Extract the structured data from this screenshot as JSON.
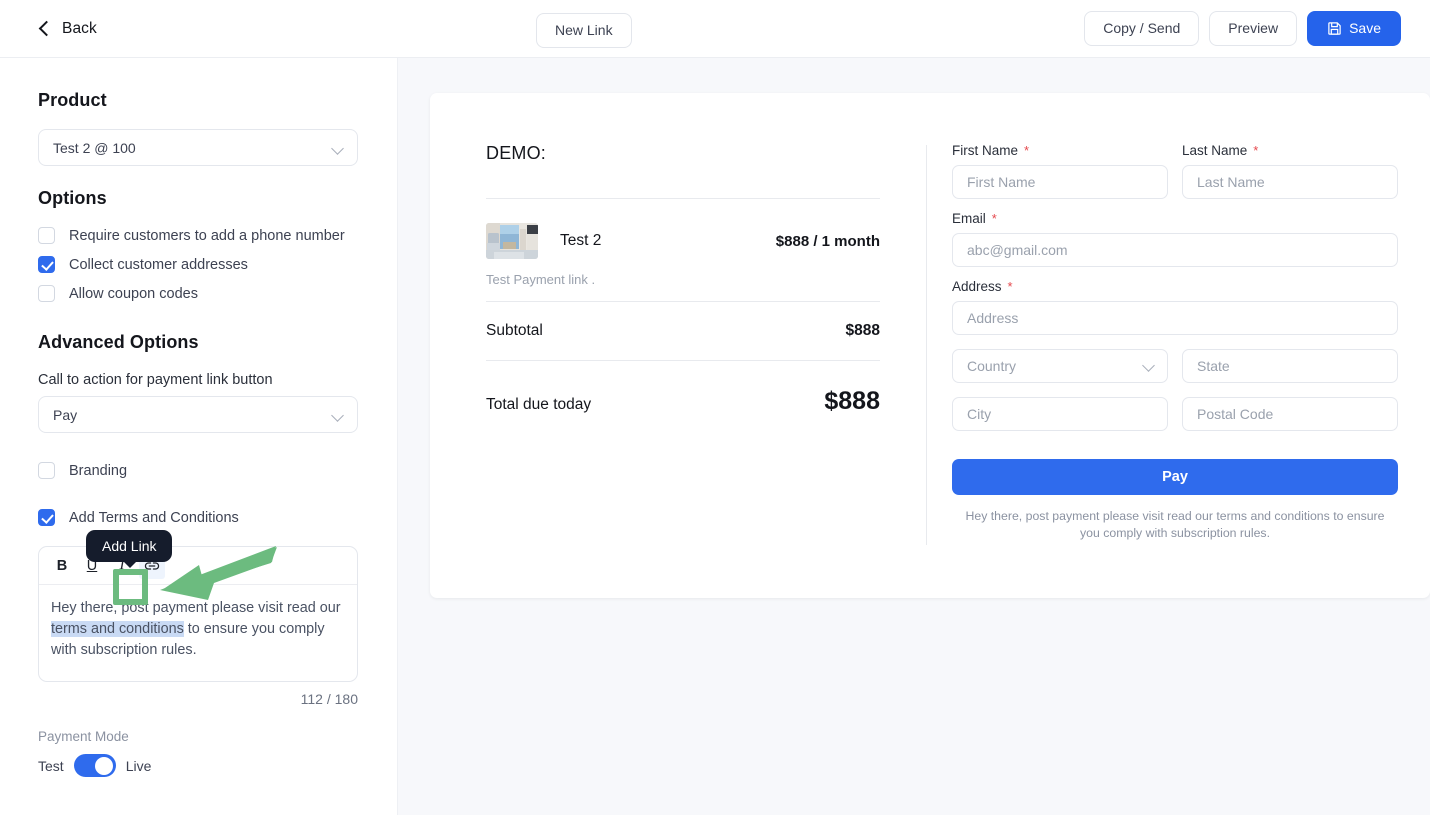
{
  "topbar": {
    "back_label": "Back",
    "back_icon": "chevron-left-icon",
    "new_link_label": "New Link",
    "copy_send_label": "Copy / Send",
    "preview_label": "Preview",
    "save_label": "Save",
    "save_icon": "floppy-disk-save-icon"
  },
  "sidebar": {
    "product": {
      "heading": "Product",
      "selected": "Test 2 @ 100",
      "chevron_icon": "chevron-down-icon"
    },
    "options": {
      "heading": "Options",
      "items": [
        {
          "label": "Require customers to add a phone number",
          "checked": false
        },
        {
          "label": "Collect customer addresses",
          "checked": true
        },
        {
          "label": "Allow coupon codes",
          "checked": false
        }
      ]
    },
    "advanced": {
      "heading": "Advanced Options",
      "cta_label": "Call to action for payment link button",
      "cta_selected": "Pay",
      "branding": {
        "label": "Branding",
        "checked": false
      },
      "terms": {
        "label": "Add Terms and Conditions",
        "checked": true
      }
    },
    "editor": {
      "toolbar": {
        "bold": "B",
        "underline": "U",
        "italic": "I",
        "link_icon": "link-chain-icon"
      },
      "text_before": "Hey there, post payment please visit read our ",
      "text_link": "terms and conditions",
      "text_after": " to ensure you comply with subscription rules.",
      "counter": "112 / 180"
    },
    "payment_mode": {
      "label": "Payment Mode",
      "left": "Test",
      "right": "Live",
      "on": true
    }
  },
  "preview": {
    "title": "DEMO:",
    "item": {
      "name": "Test 2",
      "price": "$888 / 1 month",
      "description": "Test Payment link .",
      "thumbnail_icon": "room-photo-thumbnail"
    },
    "subtotal_label": "Subtotal",
    "subtotal_value": "$888",
    "total_label": "Total due today",
    "total_value": "$888"
  },
  "form": {
    "first_name": {
      "label": "First Name",
      "required": "*",
      "placeholder": "First Name",
      "value": ""
    },
    "last_name": {
      "label": "Last Name",
      "required": "*",
      "placeholder": "Last Name",
      "value": ""
    },
    "email": {
      "label": "Email",
      "required": "*",
      "placeholder": "abc@gmail.com",
      "value": ""
    },
    "address": {
      "label": "Address",
      "required": "*",
      "placeholder": "Address",
      "value": ""
    },
    "country": {
      "placeholder": "Country",
      "value": "",
      "chevron_icon": "chevron-down-icon"
    },
    "state": {
      "placeholder": "State",
      "value": ""
    },
    "city": {
      "placeholder": "City",
      "value": ""
    },
    "postal": {
      "placeholder": "Postal Code",
      "value": ""
    },
    "pay_button": "Pay",
    "note": "Hey there, post payment please visit read our terms and conditions to ensure you comply with subscription rules."
  },
  "annotation": {
    "tooltip_label": "Add Link",
    "highlight_color": "#6cbb7f",
    "arrow_color": "#6cbb7f"
  },
  "colors": {
    "primary": "#2f6bed",
    "save": "#2563eb",
    "required": "#e5484d",
    "canvas_bg": "#f7f8fb",
    "highlight_text": "#c9daf4"
  }
}
